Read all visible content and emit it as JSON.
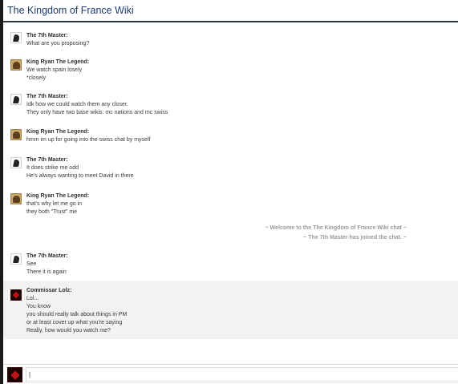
{
  "header": {
    "title": "The Kingdom of France Wiki"
  },
  "messages": [
    {
      "user": "The 7th Master:",
      "avatar": "silhouette-avatar",
      "lines": [
        "What are you proposing?"
      ]
    },
    {
      "user": "King Ryan The Legend:",
      "avatar": "portrait-avatar",
      "lines": [
        "We watch spain losely",
        "*closely"
      ]
    },
    {
      "user": "The 7th Master:",
      "avatar": "silhouette-avatar",
      "lines": [
        "Idk how we could watch them any closer.",
        "They only have two base wikis: mc nations and mc swiss"
      ]
    },
    {
      "user": "King Ryan The Legend:",
      "avatar": "portrait-avatar",
      "lines": [
        "hmm im up for going into the swiss chat by myself"
      ]
    },
    {
      "user": "The 7th Master:",
      "avatar": "silhouette-avatar",
      "lines": [
        "It does strike me odd",
        "He's always wanting to meet David in there"
      ]
    },
    {
      "user": "King Ryan The Legend:",
      "avatar": "portrait-avatar",
      "lines": [
        "that's why let me go in",
        "they both \"Trust\" me"
      ]
    },
    {
      "user": "The 7th Master:",
      "avatar": "silhouette-avatar",
      "lines": [
        "See",
        "There it is again"
      ]
    },
    {
      "user": "Commissar Lolz:",
      "avatar": "red-emblem-avatar",
      "lines": [
        "Lol...",
        "You know",
        "you should really talk about things in PM",
        "or at least cover up what you're saying",
        "Really, how would you watch me?"
      ]
    }
  ],
  "alerts": [
    "~ Welcome to the The Kingdom of France Wiki chat ~",
    "~ The 7th Master has joined the chat. ~"
  ],
  "input": {
    "value": "|",
    "avatar": "red-emblem-avatar"
  }
}
